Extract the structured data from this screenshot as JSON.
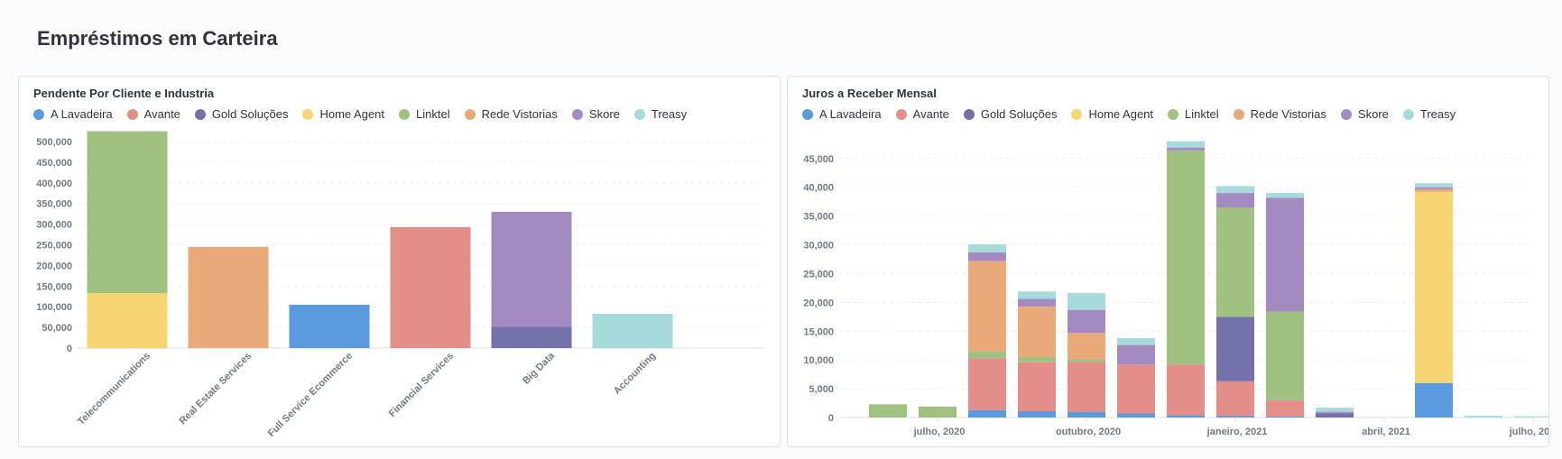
{
  "page": {
    "title": "Empréstimos em Carteira"
  },
  "colors": {
    "A Lavadeira": "#5a9be0",
    "Avante": "#e38e89",
    "Gold Soluções": "#7372aa",
    "Home Agent": "#f6d572",
    "Linktel": "#a1c180",
    "Rede Vistorias": "#e9a978",
    "Skore": "#a38bc2",
    "Treasy": "#a7dadb"
  },
  "legend_labels": [
    "A Lavadeira",
    "Avante",
    "Gold Soluções",
    "Home Agent",
    "Linktel",
    "Rede Vistorias",
    "Skore",
    "Treasy"
  ],
  "chart_data": [
    {
      "type": "bar",
      "stacked": true,
      "title": "Pendente Por Cliente e Industria",
      "xlabel": "",
      "ylabel": "",
      "ylim": [
        0,
        500000
      ],
      "yticks": [
        0,
        50000,
        100000,
        150000,
        200000,
        250000,
        300000,
        350000,
        400000,
        450000,
        500000
      ],
      "ytick_labels": [
        "0",
        "50,000",
        "100,000",
        "150,000",
        "200,000",
        "250,000",
        "300,000",
        "350,000",
        "400,000",
        "450,000",
        "500,000"
      ],
      "categories": [
        "Telecommunications",
        "Real Estate Services",
        "Full Service Ecommerce",
        "Financial Services",
        "Big Data",
        "Accounting"
      ],
      "legend_position": "top-left",
      "grid": true,
      "series": [
        {
          "name": "A Lavadeira",
          "values": [
            0,
            0,
            105000,
            0,
            0,
            0
          ]
        },
        {
          "name": "Avante",
          "values": [
            0,
            0,
            0,
            293000,
            0,
            0
          ]
        },
        {
          "name": "Gold Soluções",
          "values": [
            0,
            0,
            0,
            0,
            52000,
            0
          ]
        },
        {
          "name": "Home Agent",
          "values": [
            133000,
            0,
            0,
            0,
            0,
            0
          ]
        },
        {
          "name": "Linktel",
          "values": [
            392000,
            0,
            0,
            0,
            0,
            0
          ]
        },
        {
          "name": "Rede Vistorias",
          "values": [
            0,
            245000,
            0,
            0,
            0,
            0
          ]
        },
        {
          "name": "Skore",
          "values": [
            0,
            0,
            0,
            0,
            278000,
            0
          ]
        },
        {
          "name": "Treasy",
          "values": [
            0,
            0,
            0,
            0,
            0,
            83000
          ]
        }
      ]
    },
    {
      "type": "bar",
      "stacked": true,
      "title": "Juros a Receber Mensal",
      "xlabel": "",
      "ylabel": "",
      "ylim": [
        0,
        47000
      ],
      "yticks": [
        0,
        5000,
        10000,
        15000,
        20000,
        25000,
        30000,
        35000,
        40000,
        45000
      ],
      "ytick_labels": [
        "0",
        "5,000",
        "10,000",
        "15,000",
        "20,000",
        "25,000",
        "30,000",
        "35,000",
        "40,000",
        "45,000"
      ],
      "x": [
        "2020-06",
        "2020-07",
        "2020-08",
        "2020-09",
        "2020-10",
        "2020-11",
        "2020-12",
        "2021-01",
        "2021-02",
        "2021-03",
        "2021-04",
        "2021-05",
        "2021-06",
        "2021-07"
      ],
      "xtick_labels": [
        "julho, 2020",
        "outubro, 2020",
        "janeiro, 2021",
        "abril, 2021",
        "julho, 2021"
      ],
      "xtick_values": [
        "2020-07",
        "2020-10",
        "2021-01",
        "2021-04",
        "2021-07"
      ],
      "legend_position": "top-left",
      "grid": true,
      "series": [
        {
          "name": "A Lavadeira",
          "values": [
            0,
            0,
            1300,
            1100,
            1000,
            700,
            400,
            300,
            200,
            0,
            0,
            6000,
            0,
            0
          ]
        },
        {
          "name": "Avante",
          "values": [
            0,
            0,
            9000,
            8500,
            8700,
            8500,
            8800,
            6000,
            2800,
            0,
            0,
            0,
            0,
            0
          ]
        },
        {
          "name": "Gold Soluções",
          "values": [
            0,
            0,
            0,
            0,
            0,
            0,
            0,
            11200,
            0,
            700,
            0,
            0,
            0,
            0
          ]
        },
        {
          "name": "Home Agent",
          "values": [
            0,
            0,
            0,
            0,
            0,
            0,
            0,
            0,
            0,
            0,
            0,
            33200,
            0,
            0
          ]
        },
        {
          "name": "Linktel",
          "values": [
            2300,
            1900,
            1200,
            900,
            500,
            0,
            37200,
            19000,
            15400,
            0,
            0,
            0,
            0,
            0
          ]
        },
        {
          "name": "Rede Vistorias",
          "values": [
            0,
            0,
            15700,
            8800,
            4500,
            0,
            0,
            0,
            0,
            0,
            0,
            500,
            0,
            0
          ]
        },
        {
          "name": "Skore",
          "values": [
            0,
            0,
            1500,
            1300,
            4000,
            3400,
            500,
            2500,
            19800,
            300,
            0,
            300,
            0,
            0
          ]
        },
        {
          "name": "Treasy",
          "values": [
            0,
            0,
            1400,
            1300,
            2900,
            1200,
            1100,
            1200,
            800,
            700,
            0,
            700,
            300,
            200
          ]
        }
      ]
    }
  ]
}
